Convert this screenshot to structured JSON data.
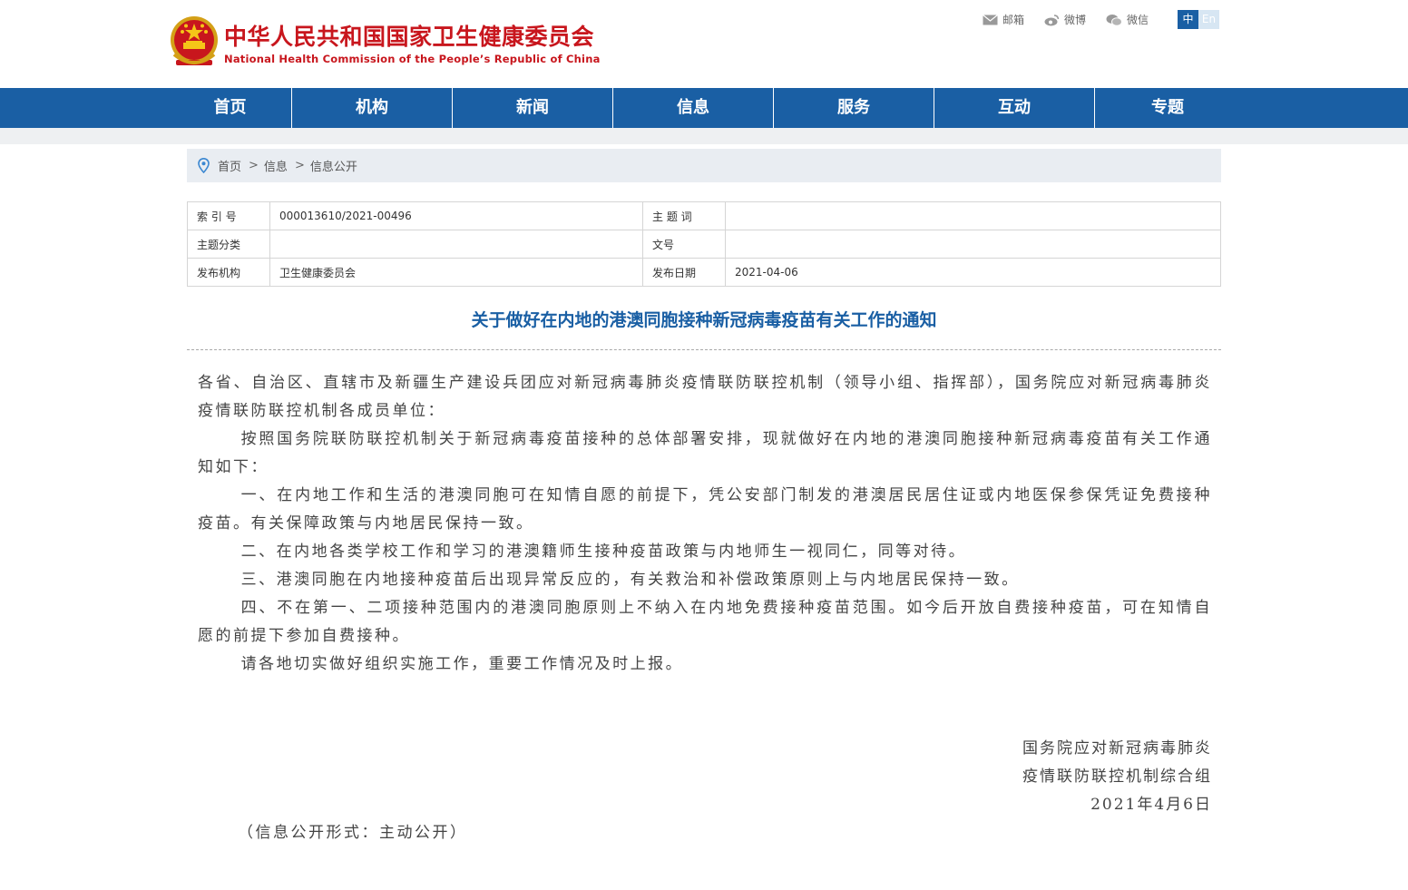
{
  "header": {
    "title_cn": "中华人民共和国国家卫生健康委员会",
    "title_en": "National Health Commission of the People’s Republic of China",
    "links": [
      {
        "label": "邮箱",
        "icon": "mail-icon"
      },
      {
        "label": "微博",
        "icon": "weibo-icon"
      },
      {
        "label": "微信",
        "icon": "wechat-icon"
      }
    ],
    "lang_zh": "中",
    "lang_en": "En"
  },
  "nav": {
    "items": [
      "首页",
      "机构",
      "新闻",
      "信息",
      "服务",
      "互动",
      "专题"
    ]
  },
  "breadcrumb": {
    "items": [
      "首页",
      "信息",
      "信息公开"
    ],
    "separator": ">"
  },
  "meta": {
    "index_label": "索 引 号",
    "index_value": "000013610/2021-00496",
    "keyword_label": "主 题 词",
    "keyword_value": "",
    "category_label": "主题分类",
    "category_value": "",
    "docno_label": "文号",
    "docno_value": "",
    "org_label": "发布机构",
    "org_value": "卫生健康委员会",
    "date_label": "发布日期",
    "date_value": "2021-04-06"
  },
  "document": {
    "title": "关于做好在内地的港澳同胞接种新冠病毒疫苗有关工作的通知",
    "paragraphs": [
      "各省、自治区、直辖市及新疆生产建设兵团应对新冠病毒肺炎疫情联防联控机制（领导小组、指挥部），国务院应对新冠病毒肺炎疫情联防联控机制各成员单位：",
      "按照国务院联防联控机制关于新冠病毒疫苗接种的总体部署安排，现就做好在内地的港澳同胞接种新冠病毒疫苗有关工作通知如下：",
      "一、在内地工作和生活的港澳同胞可在知情自愿的前提下，凭公安部门制发的港澳居民居住证或内地医保参保凭证免费接种疫苗。有关保障政策与内地居民保持一致。",
      "二、在内地各类学校工作和学习的港澳籍师生接种疫苗政策与内地师生一视同仁，同等对待。",
      "三、港澳同胞在内地接种疫苗后出现异常反应的，有关救治和补偿政策原则上与内地居民保持一致。",
      "四、不在第一、二项接种范围内的港澳同胞原则上不纳入在内地免费接种疫苗范围。如今后开放自费接种疫苗，可在知情自愿的前提下参加自费接种。",
      "请各地切实做好组织实施工作，重要工作情况及时上报。"
    ],
    "signature_line1": "国务院应对新冠病毒肺炎",
    "signature_line2": "疫情联防联控机制综合组",
    "signature_date": "2021年4月6日",
    "disclosure_note": "（信息公开形式：主动公开）"
  },
  "colors": {
    "brand_red": "#c8161d",
    "nav_blue": "#1a5fa4"
  }
}
